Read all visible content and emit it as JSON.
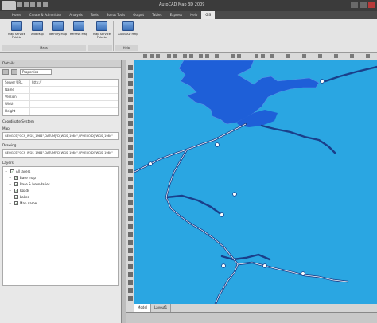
{
  "window": {
    "title": "AutoCAD Map 3D 2009"
  },
  "tabs": [
    "Home",
    "Create & Administer",
    "Analysis",
    "Tools",
    "Bonus Tools",
    "Output",
    "Tables",
    "Express",
    "Help",
    "GIS"
  ],
  "ribbon": {
    "buttons": [
      "Map Service Palette",
      "Add Map",
      "Identify Map",
      "Refresh Map",
      "Map Service Palette",
      "AutoCAD Help"
    ],
    "panels": [
      "Maps",
      "",
      "Help"
    ]
  },
  "panel": {
    "title": "Details",
    "map_label": "Properties",
    "properties": [
      {
        "key": "Server URL",
        "value": "http://"
      },
      {
        "key": "Name",
        "value": ""
      },
      {
        "key": "Version",
        "value": ""
      },
      {
        "key": "Width",
        "value": ""
      },
      {
        "key": "Height",
        "value": ""
      }
    ],
    "coordinate_section": "Coordinate System",
    "map_label2": "Map",
    "map_wkt": "GEOGCS[\"GCS_WGS_1984\",DATUM[\"D_WGS_1984\",SPHEROID[\"WGS_1984\"",
    "drawing_label": "Drawing",
    "drawing_wkt": "GEOGCS[\"GCS_WGS_1984\",DATUM[\"D_WGS_1984\",SPHEROID[\"WGS_1984\"",
    "layers_label": "Layers",
    "layers": [
      {
        "name": "All layers",
        "checked": true
      },
      {
        "name": "Base map",
        "checked": true
      },
      {
        "name": "Base & boundaries",
        "checked": true
      },
      {
        "name": "Roads",
        "checked": true
      },
      {
        "name": "Lakes",
        "checked": true
      },
      {
        "name": "Map name",
        "checked": true
      }
    ]
  },
  "map_tabs": [
    "Model",
    "Layout1"
  ],
  "colors": {
    "water": "#2aa6e2",
    "lake": "#1e5fd8",
    "river": "#1a3f8a"
  }
}
